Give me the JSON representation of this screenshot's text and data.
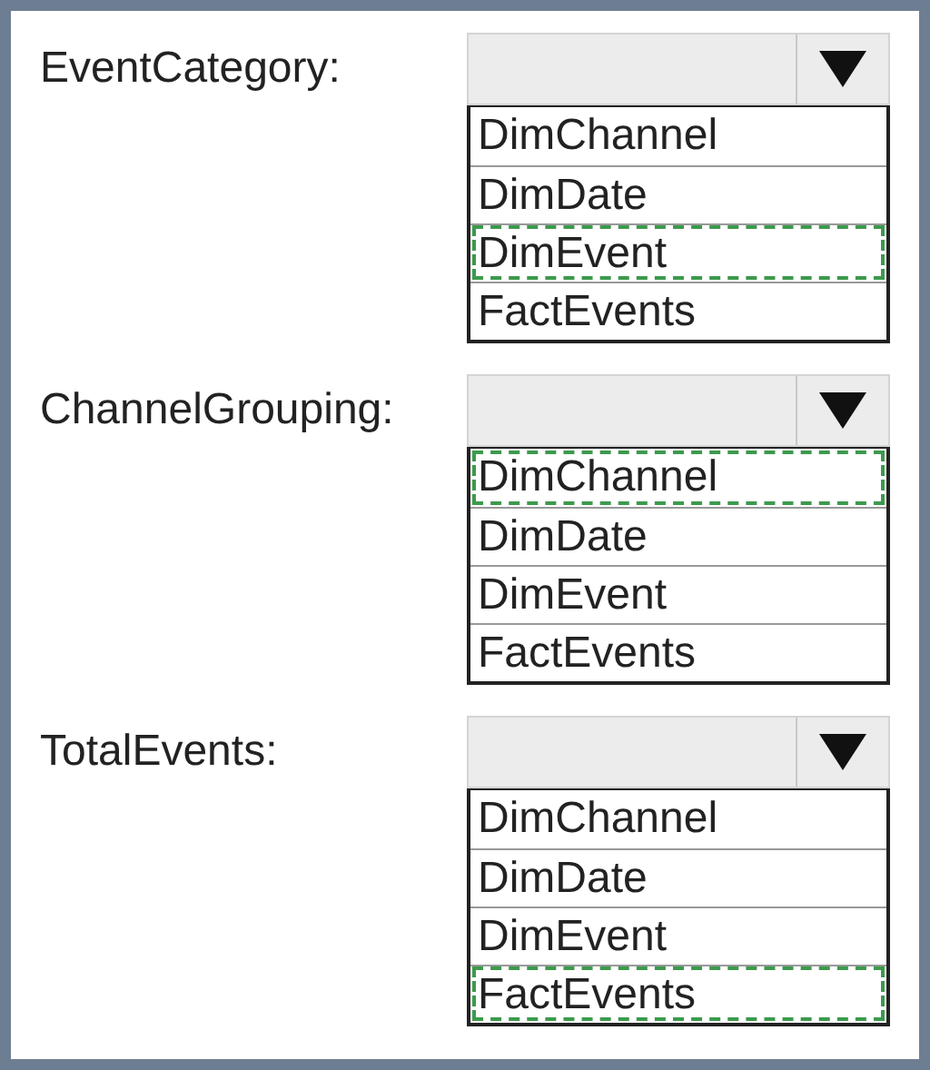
{
  "dropdowns": [
    {
      "label": "EventCategory:",
      "options": [
        {
          "text": "DimChannel",
          "selected": false
        },
        {
          "text": "DimDate",
          "selected": false
        },
        {
          "text": "DimEvent",
          "selected": true
        },
        {
          "text": "FactEvents",
          "selected": false
        }
      ]
    },
    {
      "label": "ChannelGrouping:",
      "options": [
        {
          "text": "DimChannel",
          "selected": true
        },
        {
          "text": "DimDate",
          "selected": false
        },
        {
          "text": "DimEvent",
          "selected": false
        },
        {
          "text": "FactEvents",
          "selected": false
        }
      ]
    },
    {
      "label": "TotalEvents:",
      "options": [
        {
          "text": "DimChannel",
          "selected": false
        },
        {
          "text": "DimDate",
          "selected": false
        },
        {
          "text": "DimEvent",
          "selected": false
        },
        {
          "text": "FactEvents",
          "selected": true
        }
      ]
    }
  ]
}
